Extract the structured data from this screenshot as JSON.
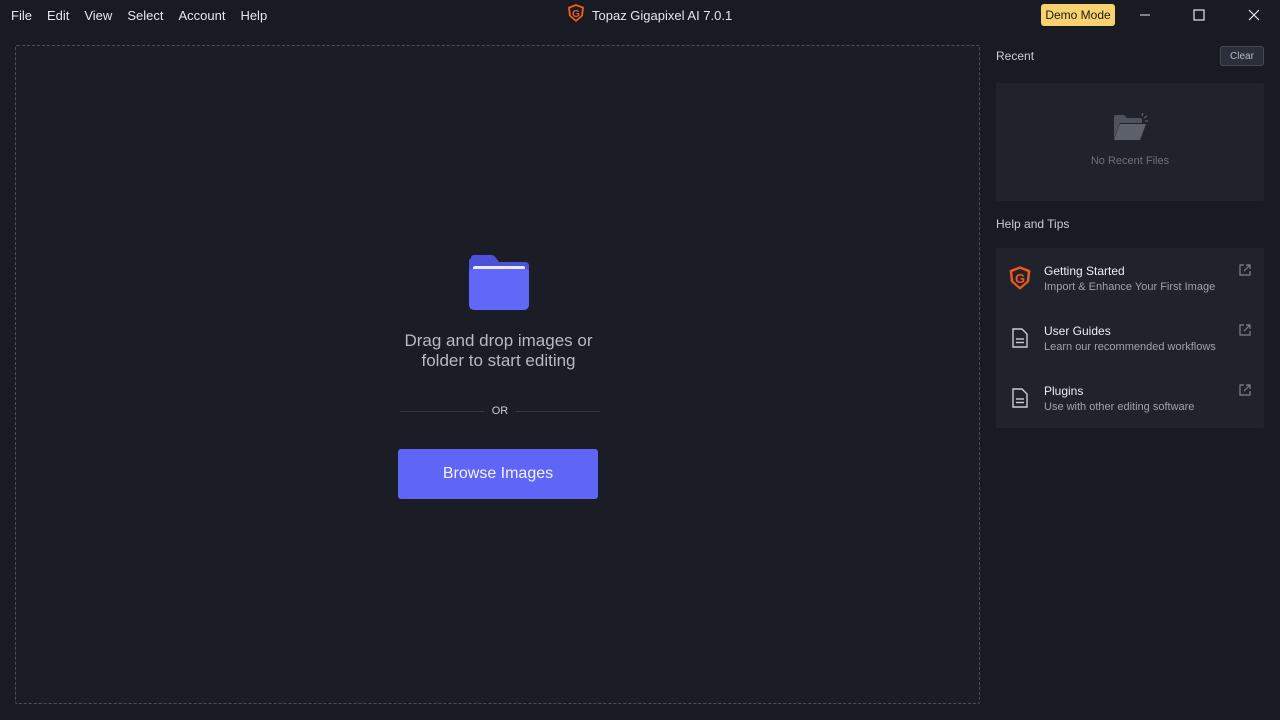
{
  "menu": {
    "items": [
      "File",
      "Edit",
      "View",
      "Select",
      "Account",
      "Help"
    ]
  },
  "app": {
    "title": "Topaz Gigapixel AI 7.0.1",
    "logo_icon": "gigapixel-logo-icon",
    "badge": "Demo Mode"
  },
  "window_controls": {
    "minimize_icon": "minimize-icon",
    "maximize_icon": "maximize-icon",
    "close_icon": "close-icon"
  },
  "dropzone": {
    "icon": "folder-icon",
    "line1": "Drag and drop images or",
    "line2": "folder to start editing",
    "or_text": "OR",
    "browse_label": "Browse Images"
  },
  "recent": {
    "label": "Recent",
    "clear_label": "Clear",
    "empty_icon": "open-folder-icon",
    "empty_text": "No Recent Files"
  },
  "help": {
    "label": "Help and Tips",
    "items": [
      {
        "title": "Getting Started",
        "subtitle": "Import & Enhance Your First Image",
        "icon": "gigapixel-logo-icon"
      },
      {
        "title": "User Guides",
        "subtitle": "Learn our recommended workflows",
        "icon": "document-icon"
      },
      {
        "title": "Plugins",
        "subtitle": "Use with other editing software",
        "icon": "document-icon"
      }
    ]
  },
  "colors": {
    "background": "#181b22",
    "accent": "#5f65f5",
    "badge": "#f9d270",
    "brand": "#f05a1e"
  }
}
